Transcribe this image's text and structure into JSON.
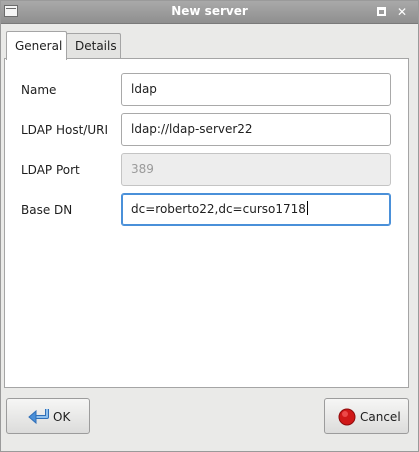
{
  "window": {
    "title": "New server"
  },
  "tabs": [
    {
      "label": "General",
      "active": true
    },
    {
      "label": "Details",
      "active": false
    }
  ],
  "form": {
    "name": {
      "label": "Name",
      "value": "ldap"
    },
    "host": {
      "label": "LDAP Host/URI",
      "value": "ldap://ldap-server22"
    },
    "port": {
      "label": "LDAP Port",
      "value": "389",
      "disabled": true
    },
    "base_dn": {
      "label": "Base DN",
      "value": "dc=roberto22,dc=curso1718",
      "focused": true
    }
  },
  "buttons": {
    "ok": {
      "label": "OK",
      "icon": "arrow-return-icon",
      "color": "#4a8fd8"
    },
    "cancel": {
      "label": "Cancel",
      "icon": "stop-icon",
      "color": "#d01818"
    }
  },
  "colors": {
    "focus": "#4a90d9",
    "titlebar": "#9a9a9a"
  }
}
